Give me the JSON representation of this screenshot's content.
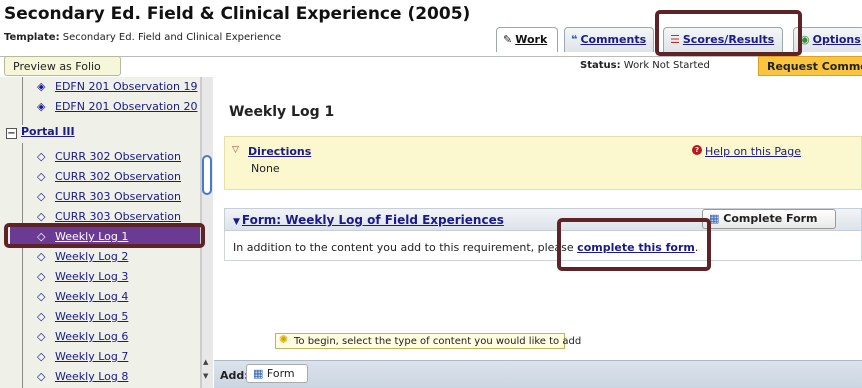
{
  "header": {
    "title": "Secondary Ed. Field & Clinical Experience (2005)",
    "template_label": "Template:",
    "template_value": "Secondary Ed. Field and Clinical Experience"
  },
  "tabs": [
    {
      "label": "Work",
      "icon": "pencil-icon"
    },
    {
      "label": "Comments",
      "icon": "quote-icon"
    },
    {
      "label": "Scores/Results",
      "icon": "scores-icon"
    },
    {
      "label": "Options",
      "icon": "options-icon"
    }
  ],
  "toolbar": {
    "preview_label": "Preview as Folio",
    "status_label": "Status:",
    "status_value": "Work Not Started",
    "request_label": "Request Comments"
  },
  "sidebar": {
    "top_items": [
      "EDFN 201 Observation 19",
      "EDFN 201 Observation 20"
    ],
    "section_title": "Portal III",
    "section_toggle": "−",
    "items": [
      "CURR 302 Observation",
      "CURR 302 Observation",
      "CURR 303 Observation",
      "CURR 303 Observation",
      "Weekly Log 1",
      "Weekly Log 2",
      "Weekly Log 3",
      "Weekly Log 4",
      "Weekly Log 5",
      "Weekly Log 6",
      "Weekly Log 7",
      "Weekly Log 8"
    ],
    "selected_index": 4
  },
  "main": {
    "title": "Weekly Log 1",
    "directions_title": "Directions",
    "directions_text": "None",
    "help_label": "Help on this Page",
    "form_title": "Form: Weekly Log of Field Experiences",
    "complete_form_label": "Complete Form",
    "form_text_prefix": "In addition to the content you add to this requirement, please ",
    "form_link": "complete this form",
    "form_text_suffix": "."
  },
  "tooltip": {
    "text": "To begin, select the type of content you would like to add"
  },
  "addbar": {
    "label": "Add:",
    "form_button": "Form"
  },
  "colors": {
    "accent": "#5e2326",
    "selected": "#6b3a93",
    "request": "#f9c43f",
    "directions_bg": "#fbf7cf"
  }
}
